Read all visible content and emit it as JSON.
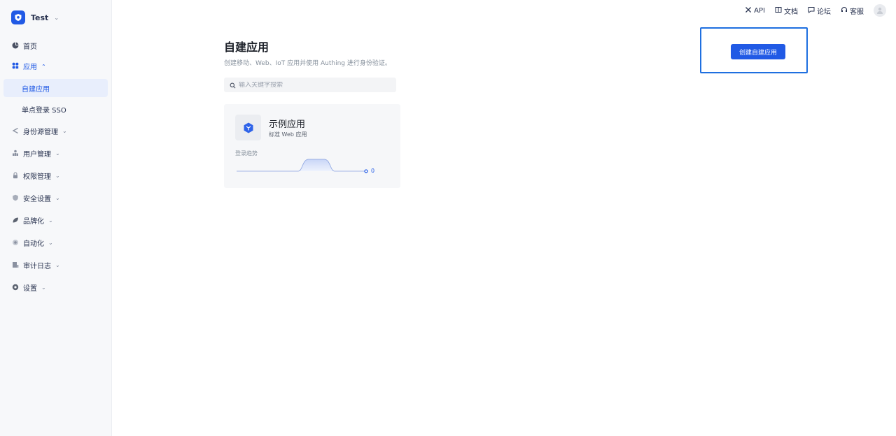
{
  "tenant": {
    "name": "Test"
  },
  "sidebar": {
    "items": [
      {
        "label": "首页",
        "icon": "pie-chart-icon"
      },
      {
        "label": "应用",
        "icon": "apps-icon",
        "expanded": true,
        "children": [
          {
            "label": "自建应用",
            "selected": true
          },
          {
            "label": "单点登录 SSO"
          }
        ]
      },
      {
        "label": "身份源管理",
        "icon": "share-icon"
      },
      {
        "label": "用户管理",
        "icon": "users-icon"
      },
      {
        "label": "权限管理",
        "icon": "lock-icon"
      },
      {
        "label": "安全设置",
        "icon": "shield-icon"
      },
      {
        "label": "品牌化",
        "icon": "leaf-icon"
      },
      {
        "label": "自动化",
        "icon": "flower-icon"
      },
      {
        "label": "审计日志",
        "icon": "log-icon"
      },
      {
        "label": "设置",
        "icon": "gear-icon"
      }
    ]
  },
  "topbar": {
    "api": "API",
    "docs": "文档",
    "forum": "论坛",
    "support": "客服"
  },
  "main": {
    "title": "自建应用",
    "description": "创建移动、Web、IoT 应用并使用 Authing 进行身份验证。",
    "search_placeholder": "输入关键字搜索",
    "create_button": "创建自建应用",
    "apps": [
      {
        "name": "示例应用",
        "type": "标准 Web 应用",
        "trend_label": "登录趋势",
        "trend_value": "0"
      }
    ]
  },
  "colors": {
    "primary": "#215ae5",
    "selected_bg": "#e8eefc",
    "highlight_border": "#1e6fe0"
  }
}
